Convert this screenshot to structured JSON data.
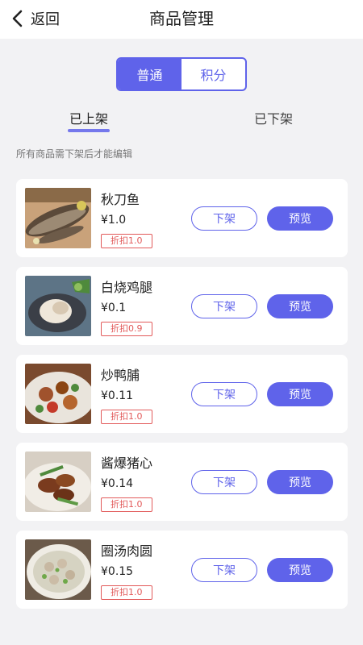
{
  "header": {
    "back_label": "返回",
    "title": "商品管理"
  },
  "segment": {
    "options": [
      "普通",
      "积分"
    ],
    "selected": "普通"
  },
  "tabs": {
    "items": [
      "已上架",
      "已下架"
    ],
    "selected": "已上架"
  },
  "hint": "所有商品需下架后才能编辑",
  "colors": {
    "accent": "#5f63ea",
    "discount": "#e25a5a",
    "background": "#f2f2f4"
  },
  "actions": {
    "delist_label": "下架",
    "preview_label": "预览"
  },
  "products": [
    {
      "name": "秋刀鱼",
      "price": "¥1.0",
      "discount": "折扣1.0",
      "image_icon": "grilled-fish"
    },
    {
      "name": "白烧鸡腿",
      "price": "¥0.1",
      "discount": "折扣0.9",
      "image_icon": "chicken-leg-plate"
    },
    {
      "name": "炒鸭脯",
      "price": "¥0.11",
      "discount": "折扣1.0",
      "image_icon": "stir-fried-duck"
    },
    {
      "name": "酱爆猪心",
      "price": "¥0.14",
      "discount": "折扣1.0",
      "image_icon": "braised-pork-heart"
    },
    {
      "name": "圈汤肉圆",
      "price": "¥0.15",
      "discount": "折扣1.0",
      "image_icon": "meatball-soup"
    }
  ]
}
